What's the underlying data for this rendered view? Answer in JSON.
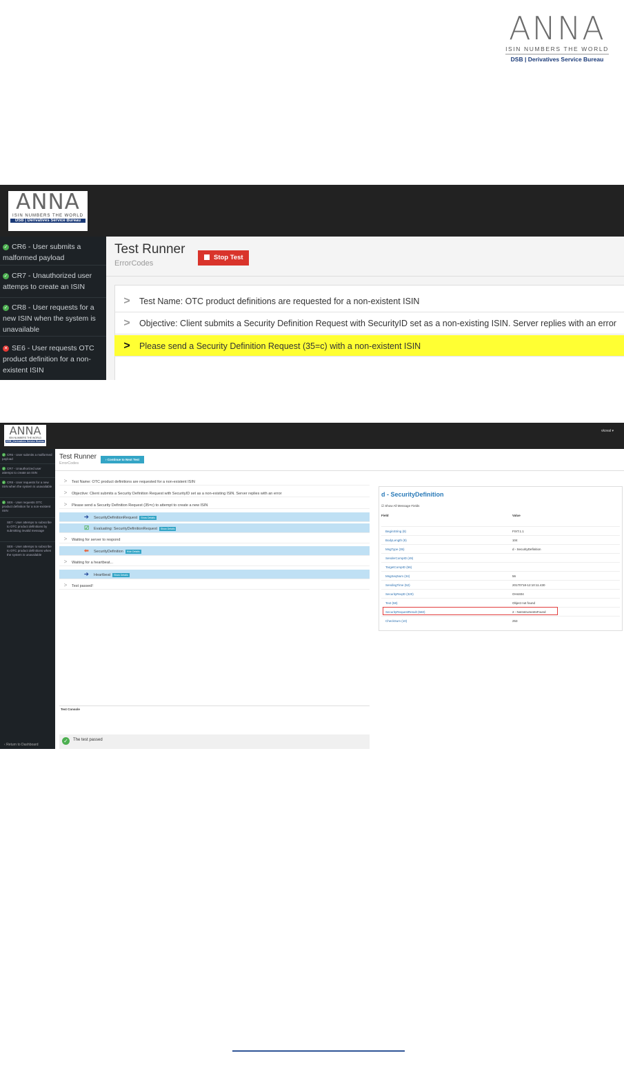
{
  "logo": {
    "wordmark": "ANNA",
    "line1": "ISIN NUMBERS THE WORLD",
    "line2": "DSB | Derivatives Service Bureau"
  },
  "shot1": {
    "sidebar": [
      {
        "status": "ok",
        "label": "CR6 - User submits a malformed payload"
      },
      {
        "status": "ok",
        "label": "CR7 - Unauthorized user attemps to create an ISIN"
      },
      {
        "status": "ok",
        "label": "CR8 - User requests for a new ISIN when the system is unavailable"
      },
      {
        "status": "error",
        "label": "SE6 - User requests OTC product definition for a non-existent ISIN"
      }
    ],
    "title": "Test Runner",
    "subtitle": "ErrorCodes",
    "stop_label": "Stop Test",
    "rows": [
      "Test Name: OTC product definitions are requested for a non-existent ISIN",
      "Objective: Client submits a Security Definition Request with SecurityID set as a non-existing ISIN. Server replies with an error",
      "Please send a Security Definition Request (35=c) with a non-existent ISIN"
    ]
  },
  "shot2": {
    "user": "vkoval ▾",
    "sidebar": [
      {
        "status": "ok",
        "label": "CR6 - User submits a malformed payload"
      },
      {
        "status": "ok",
        "label": "CR7 - Unauthorized user attemps to create an ISIN"
      },
      {
        "status": "ok",
        "label": "CR8 - User requests for a new ISIN when the system is unavailable"
      },
      {
        "status": "ok",
        "label": "SE6 - User requests OTC product definition for a non-existent ISIN"
      },
      {
        "status": "none",
        "label": "SE7 - User attemps to subscribe to OTC product definitions by submitting invalid message"
      },
      {
        "status": "none",
        "label": "SE8 - User attemps to subscribe to OTC product definitions when the system is unavailable"
      }
    ],
    "back_label": "Return to Dashboard",
    "title": "Test Runner",
    "subtitle": "ErrorCodes",
    "continue_label": "Continue to Next Test",
    "steps": [
      {
        "kind": "plain",
        "text": "Test Name: OTC product definitions are requested for a non-existent ISIN"
      },
      {
        "kind": "plain",
        "text": "Objective: Client submits a Security Definition Request with SecurityID set as a non-existing ISIN. Server replies with an error"
      },
      {
        "kind": "plain",
        "text": "Please send a Security Definition Request (35=c) to attempt to create a new ISIN"
      },
      {
        "kind": "out",
        "text": "SecurityDefinitionRequest",
        "btn": "Show Details"
      },
      {
        "kind": "check",
        "text": "Evaluating: SecurityDefinitionRequest",
        "btn": "Show Details"
      },
      {
        "kind": "plain",
        "text": "Waiting for server to respond"
      },
      {
        "kind": "in",
        "text": "SecurityDefinition",
        "btn": "Hide Details"
      },
      {
        "kind": "plain",
        "text": "Waiting for a heartbeat..."
      },
      {
        "kind": "out",
        "text": "Heartbeat",
        "btn": "Show Details"
      },
      {
        "kind": "plain",
        "text": "Test passed!"
      }
    ],
    "console_label": "Test Console",
    "console_text": "The test passed",
    "detail": {
      "title": "d - SecurityDefinition",
      "show_all": "Show All Message Fields",
      "col_field": "Field",
      "col_value": "Value",
      "rows": [
        {
          "f": "BeginString (8)",
          "v": "FIXT.1.1"
        },
        {
          "f": "BodyLength (9)",
          "v": "104"
        },
        {
          "f": "MsgType (35)",
          "v": "d - SecurityDefinition"
        },
        {
          "f": "SenderCompID (49)",
          "v": ""
        },
        {
          "f": "TargetCompID (56)",
          "v": ""
        },
        {
          "f": "MsgSeqNum (34)",
          "v": "56"
        },
        {
          "f": "SendingTime (52)",
          "v": "20170718-12:10:11.430"
        },
        {
          "f": "SecurityReqID (320)",
          "v": "OH4404"
        },
        {
          "f": "Text (58)",
          "v": "Object not found"
        },
        {
          "f": "SecurityRequestResult (560)",
          "v": "2 - NoInstrumentsFound"
        },
        {
          "f": "CheckSum (10)",
          "v": "253"
        }
      ]
    }
  }
}
